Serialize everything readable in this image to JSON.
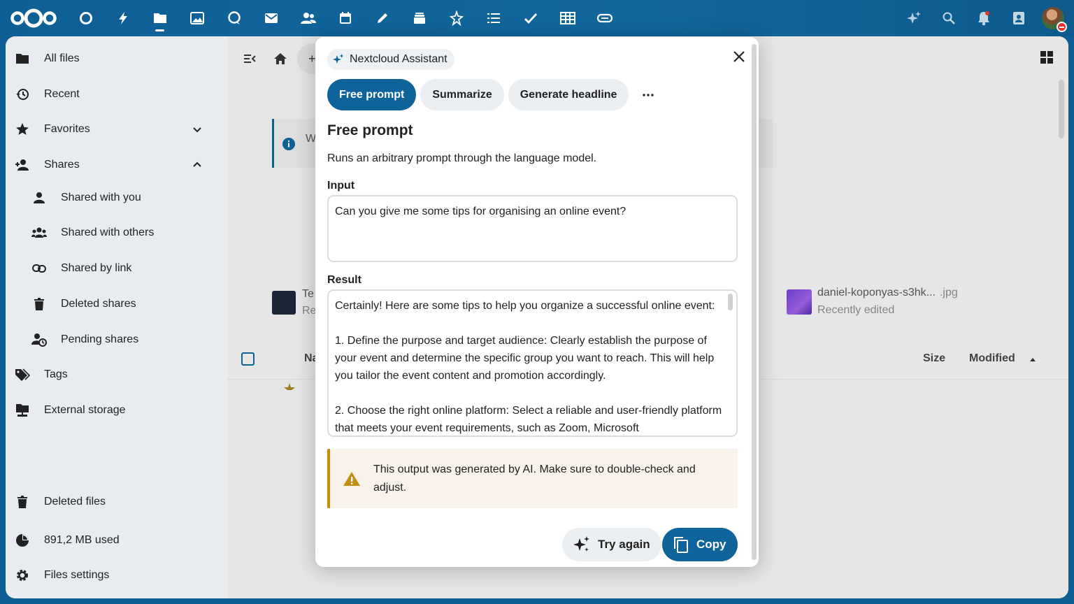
{
  "topbar": {
    "apps": [
      {
        "name": "dashboard-icon"
      },
      {
        "name": "activity-icon"
      },
      {
        "name": "files-icon",
        "active": true
      },
      {
        "name": "photos-icon"
      },
      {
        "name": "talk-icon"
      },
      {
        "name": "mail-icon"
      },
      {
        "name": "contacts-icon"
      },
      {
        "name": "calendar-icon"
      },
      {
        "name": "notes-icon"
      },
      {
        "name": "deck-icon"
      },
      {
        "name": "analytics-icon"
      },
      {
        "name": "list-icon"
      },
      {
        "name": "tasks-icon"
      },
      {
        "name": "tables-icon"
      },
      {
        "name": "link-icon"
      }
    ],
    "right_icons": [
      "assistant-icon",
      "search-icon",
      "notifications-icon",
      "contacts-menu-icon"
    ]
  },
  "sidebar": {
    "items": [
      {
        "label": "All files",
        "icon": "folder-icon"
      },
      {
        "label": "Recent",
        "icon": "history-icon"
      },
      {
        "label": "Favorites",
        "icon": "star-icon",
        "chevron": "down"
      },
      {
        "label": "Shares",
        "icon": "share-icon",
        "chevron": "up"
      },
      {
        "label": "Shared with you",
        "icon": "user-icon",
        "sub": true
      },
      {
        "label": "Shared with others",
        "icon": "users-icon",
        "sub": true
      },
      {
        "label": "Shared by link",
        "icon": "link-icon",
        "sub": true
      },
      {
        "label": "Deleted shares",
        "icon": "trash-icon",
        "sub": true
      },
      {
        "label": "Pending shares",
        "icon": "pending-icon",
        "sub": true
      },
      {
        "label": "Tags",
        "icon": "tag-icon"
      },
      {
        "label": "External storage",
        "icon": "storage-icon"
      }
    ],
    "bottom": [
      {
        "label": "Deleted files",
        "icon": "trash-icon"
      },
      {
        "label": "891,2 MB used",
        "icon": "quota-icon"
      },
      {
        "label": "Files settings",
        "icon": "settings-icon"
      }
    ]
  },
  "content": {
    "breadcrumb_home": "home-icon",
    "info_partial": "W",
    "recent_partial_title": "Te",
    "recent_partial_sub": "Re",
    "recent_file_name": "daniel-koponyas-s3hk...",
    "recent_file_ext": ".jpg",
    "recent_file_sub": "Recently edited",
    "col_name_partial": "Na",
    "col_size": "Size",
    "col_modified": "Modified"
  },
  "modal": {
    "badge": "Nextcloud Assistant",
    "tabs": [
      "Free prompt",
      "Summarize",
      "Generate headline"
    ],
    "active_tab": 0,
    "title": "Free prompt",
    "description": "Runs an arbitrary prompt through the language model.",
    "input_label": "Input",
    "input_value": "Can you give me some tips for organising an online event?",
    "result_label": "Result",
    "result_paragraphs": [
      "Certainly! Here are some tips to help you organize a successful online event:",
      "1. Define the purpose and target audience: Clearly establish the purpose of your event and determine the specific group you want to reach. This will help you tailor the event content and promotion accordingly.",
      "2. Choose the right online platform: Select a reliable and user-friendly platform that meets your event requirements, such as Zoom, Microsoft"
    ],
    "warning": "This output was generated by AI. Make sure to double-check and adjust.",
    "try_again": "Try again",
    "copy": "Copy"
  }
}
